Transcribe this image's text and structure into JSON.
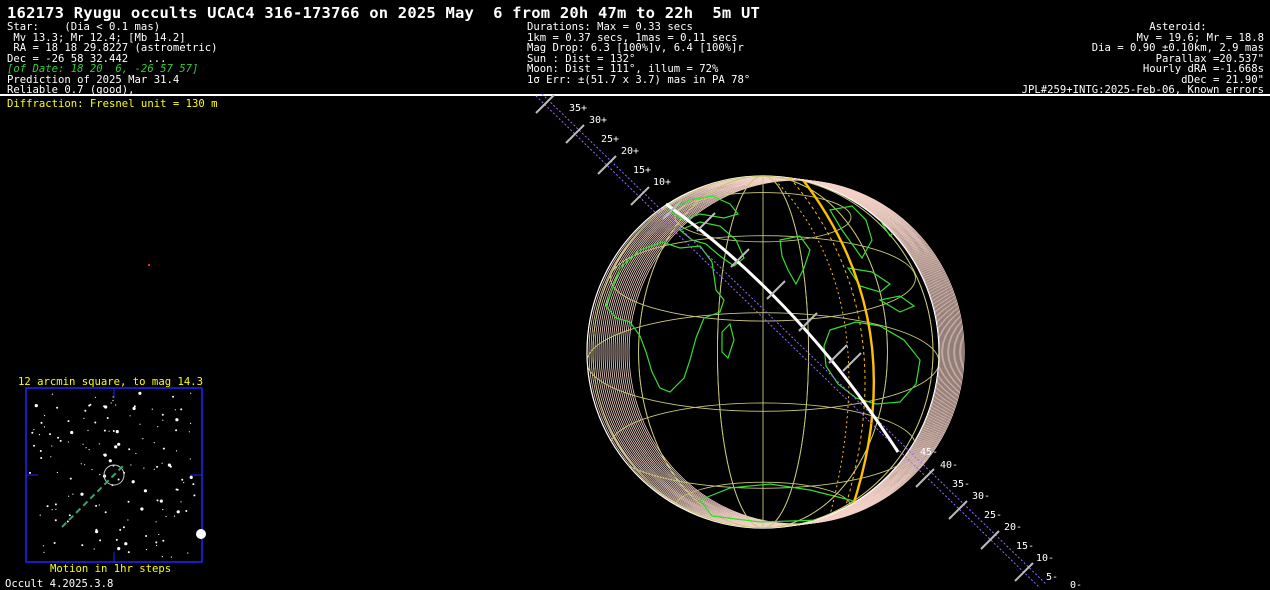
{
  "title": "162173 Ryugu occults UCAC4 316-173766 on 2025 May  6 from 20h 47m to 22h  5m UT",
  "star_block": [
    "Star:    (Dia < 0.1 mas)",
    " Mv 13.3; Mr 12.4; [Mb 14.2]",
    " RA = 18 18 29.8227 (astrometric)",
    "Dec = -26 58 32.442   ..."
  ],
  "star_block_of_date": "[of Date: 18 20  6, -26 57 57]",
  "star_block_tail": [
    "Prediction of 2025 Mar 31.4",
    "Reliable 0.7 (good),"
  ],
  "event_block": [
    "Durations: Max = 0.33 secs",
    "1km = 0.37 secs, 1mas = 0.11 secs",
    "Mag Drop: 6.3 [100%]v, 6.4 [100%]r",
    "Sun : Dist = 132°",
    "Moon: Dist = 111°, illum = 72%",
    "1σ Err: ±(51.7 x 3.7) mas in PA 78°"
  ],
  "asteroid_block": [
    "Asteroid:         ",
    "Mv = 19.6; Mr = 18.8",
    "Dia = 0.90 ±0.10km, 2.9 mas",
    "Parallax =20.537\"",
    "Hourly dRA =-1.668s",
    "dDec = 21.90\"",
    "JPL#259+INTG:2025-Feb-06, Known errors"
  ],
  "diffraction": "Diffraction: Fresnel unit = 130 m",
  "star_chart": {
    "title": "12 arcmin square, to mag 14.3",
    "footer": "Motion in 1hr steps"
  },
  "version": "Occult 4.2025.3.8",
  "path_labels_upper": [
    "35+",
    "30+",
    "25+",
    "20+",
    "15+",
    "10+"
  ],
  "path_labels_lower": [
    "45-",
    "40-",
    "35-",
    "30-",
    "25-",
    "20-",
    "15-",
    "10-",
    "5-",
    "0-"
  ],
  "colors": {
    "background": "#000000",
    "coastline": "#33dd33",
    "grid": "#c8c878",
    "shadow_limit": "#ffc000",
    "path": "#ffffff",
    "error_path": "#9966ff",
    "chart_frame": "#2222ff",
    "heading_text": "#ffff00"
  }
}
